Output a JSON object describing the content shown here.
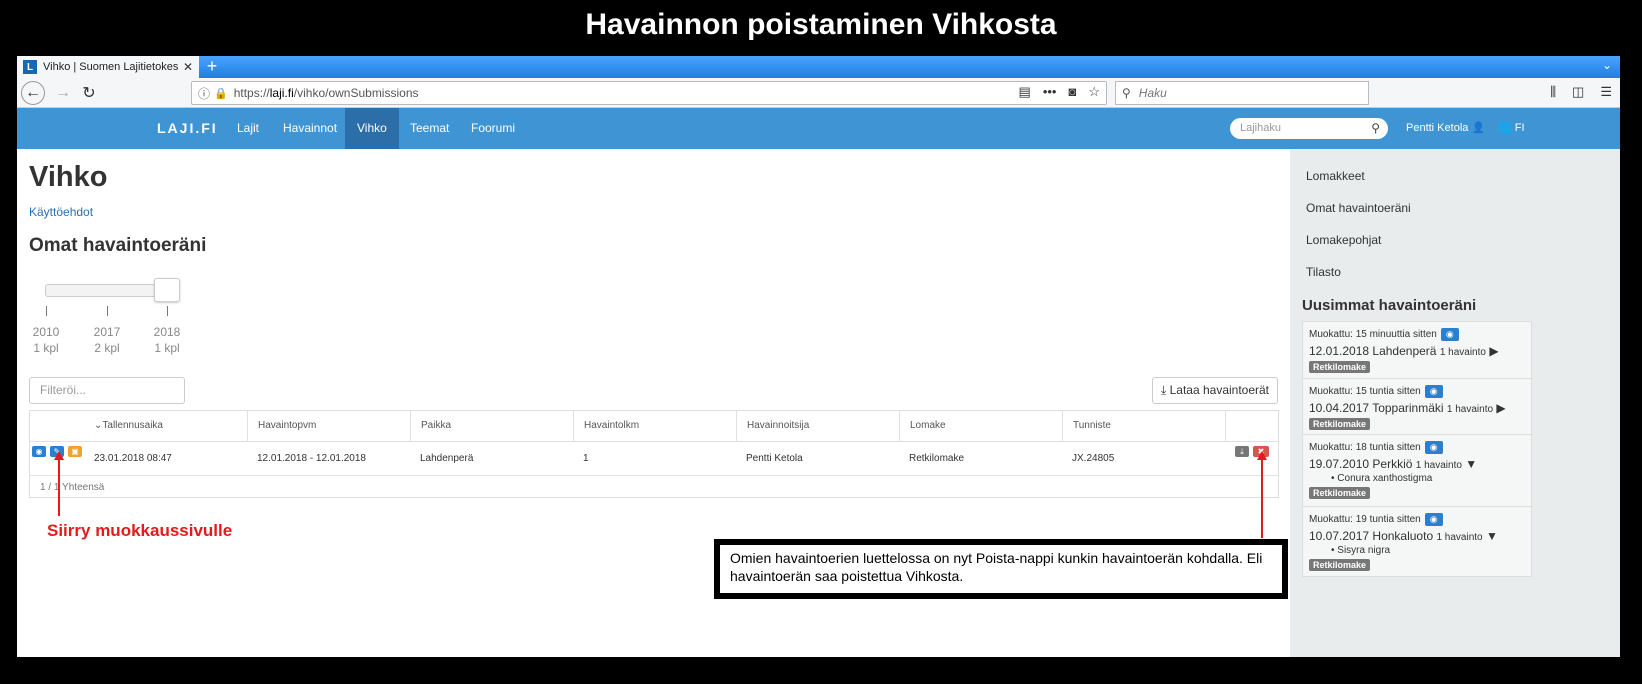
{
  "slide": {
    "title": "Havainnon poistaminen Vihkosta"
  },
  "browser": {
    "tab_title": "Vihko | Suomen Lajitietokeskus",
    "tab_favicon": "L",
    "url_prefix": "https://",
    "url_host": "laji.fi",
    "url_path": "/vihko/ownSubmissions",
    "search_placeholder": "Haku"
  },
  "sitenav": {
    "brand": "LAJI.FI",
    "links": [
      "Lajit",
      "Havainnot",
      "Vihko",
      "Teemat",
      "Foorumi"
    ],
    "active": "Vihko",
    "search_placeholder": "Lajihaku",
    "user": "Pentti Ketola",
    "lang": "FI"
  },
  "main": {
    "title": "Vihko",
    "terms_link": "Käyttöehdot",
    "section_title": "Omat havaintoeräni",
    "slider": {
      "labels": [
        {
          "year": "2010",
          "count": "1 kpl"
        },
        {
          "year": "2017",
          "count": "2 kpl"
        },
        {
          "year": "2018",
          "count": "1 kpl"
        }
      ]
    },
    "filter_placeholder": "Filteröi...",
    "download_label": "Lataa havaintoerät",
    "table": {
      "headers": [
        "Tallennusaika",
        "Havaintopvm",
        "Paikka",
        "Havaintolkm",
        "Havainnoitsija",
        "Lomake",
        "Tunniste"
      ],
      "rows": [
        [
          "23.01.2018 08:47",
          "12.01.2018 - 12.01.2018",
          "Lahdenperä",
          "1",
          "Pentti Ketola",
          "Retkilomake",
          "JX.24805"
        ]
      ],
      "footer": "1 / 1 Yhteensä"
    },
    "annotation_left": "Siirry muokkaussivulle",
    "callout": "Omien havaintoerien luettelossa on nyt Poista-nappi kunkin havaintoerän kohdalla. Eli havaintoerän saa poistettua Vihkosta."
  },
  "sidebar": {
    "links": [
      "Lomakkeet",
      "Omat havaintoeräni",
      "Lomakepohjat",
      "Tilasto"
    ],
    "recent_heading": "Uusimmat havaintoeräni",
    "recent": [
      {
        "modified": "Muokattu: 15 minuuttia sitten",
        "date": "12.01.2018",
        "place": "Lahdenperä",
        "count": "1 havainto",
        "caret": "▶",
        "tag": "Retkilomake",
        "taxon": ""
      },
      {
        "modified": "Muokattu: 15 tuntia sitten",
        "date": "10.04.2017",
        "place": "Topparinmäki",
        "count": "1 havainto",
        "caret": "▶",
        "tag": "Retkilomake",
        "taxon": ""
      },
      {
        "modified": "Muokattu: 18 tuntia sitten",
        "date": "19.07.2010",
        "place": "Perkkiö",
        "count": "1 havainto",
        "caret": "▼",
        "tag": "Retkilomake",
        "taxon": "Conura xanthostigma"
      },
      {
        "modified": "Muokattu: 19 tuntia sitten",
        "date": "10.07.2017",
        "place": "Honkaluoto",
        "count": "1 havainto",
        "caret": "▼",
        "tag": "Retkilomake",
        "taxon": "Sisyra nigra"
      }
    ]
  },
  "colors": {
    "nav_blue": "#3f95d4",
    "nav_active": "#2c6fa8",
    "delete_red": "#d9534f",
    "annotation_red": "#e41a1c"
  }
}
